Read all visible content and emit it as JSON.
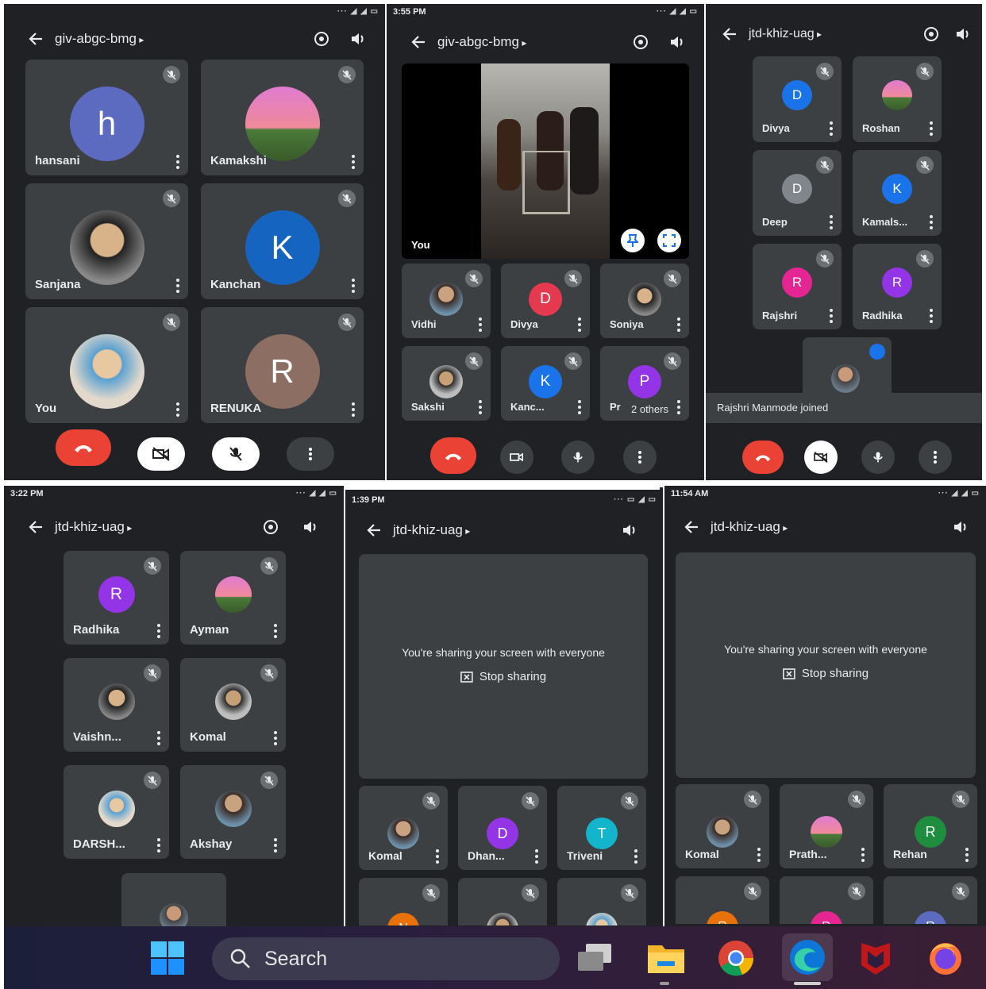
{
  "panel1": {
    "title": "giv-abgc-bmg",
    "participants": [
      {
        "name": "hansani",
        "avatar": "h",
        "color": "#5c6bc0"
      },
      {
        "name": "Kamakshi",
        "avatar": "photo"
      },
      {
        "name": "Sanjana",
        "avatar": "photo"
      },
      {
        "name": "Kanchan",
        "avatar": "K",
        "color": "#1565c0"
      },
      {
        "name": "You",
        "avatar": "photo"
      },
      {
        "name": "RENUKA",
        "avatar": "R",
        "color": "#8d6e63"
      }
    ]
  },
  "panel2": {
    "time": "3:55 PM",
    "title": "giv-abgc-bmg",
    "main_label": "You",
    "participants": [
      {
        "name": "Vidhi",
        "avatar": "photo"
      },
      {
        "name": "Divya",
        "avatar": "D",
        "color": "#e53950"
      },
      {
        "name": "Soniya",
        "avatar": "photo"
      },
      {
        "name": "Sakshi",
        "avatar": "photo"
      },
      {
        "name": "Kanc...",
        "avatar": "K",
        "color": "#1a73e8"
      },
      {
        "name": "Pr",
        "avatar": "P",
        "color": "#9334e6"
      }
    ],
    "others": "2 others"
  },
  "panel3": {
    "title": "jtd-khiz-uag",
    "participants": [
      {
        "name": "Divya",
        "avatar": "D",
        "color": "#1a73e8"
      },
      {
        "name": "Roshan",
        "avatar": "photo"
      },
      {
        "name": "Deep",
        "avatar": "D",
        "color": "#80868b"
      },
      {
        "name": "Kamals...",
        "avatar": "K",
        "color": "#1a73e8"
      },
      {
        "name": "Rajshri",
        "avatar": "R",
        "color": "#e52592"
      },
      {
        "name": "Radhika",
        "avatar": "R",
        "color": "#9334e6"
      }
    ],
    "toast": "Rajshri Manmode joined"
  },
  "panel4": {
    "time": "3:22 PM",
    "title": "jtd-khiz-uag",
    "participants": [
      {
        "name": "Radhika",
        "avatar": "R",
        "color": "#9334e6"
      },
      {
        "name": "Ayman",
        "avatar": "photo"
      },
      {
        "name": "Vaishn...",
        "avatar": "photo"
      },
      {
        "name": "Komal",
        "avatar": "photo"
      },
      {
        "name": "DARSH...",
        "avatar": "photo"
      },
      {
        "name": "Akshay",
        "avatar": "photo"
      }
    ]
  },
  "panel5": {
    "time": "1:39 PM",
    "title": "jtd-khiz-uag",
    "share_message": "You're sharing your screen with everyone",
    "stop_label": "Stop sharing",
    "participants": [
      {
        "name": "Komal",
        "avatar": "photo"
      },
      {
        "name": "Dhan...",
        "avatar": "D",
        "color": "#9334e6"
      },
      {
        "name": "Triveni",
        "avatar": "T",
        "color": "#12b5cb"
      }
    ],
    "partial_avatars": [
      "N"
    ]
  },
  "panel6": {
    "time": "11:54 AM",
    "title": "jtd-khiz-uag",
    "share_message": "You're sharing your screen with everyone",
    "stop_label": "Stop sharing",
    "participants": [
      {
        "name": "Komal",
        "avatar": "photo"
      },
      {
        "name": "Prath...",
        "avatar": "photo"
      },
      {
        "name": "Rehan",
        "avatar": "R",
        "color": "#1e8e3e"
      }
    ],
    "partial_avatars": [
      "R",
      "D",
      "R"
    ]
  },
  "taskbar": {
    "search_label": "Search",
    "apps": [
      "windows-start-icon",
      "task-view-icon",
      "file-explorer-icon",
      "chrome-icon",
      "edge-icon",
      "mcafee-icon",
      "firefox-icon"
    ]
  }
}
